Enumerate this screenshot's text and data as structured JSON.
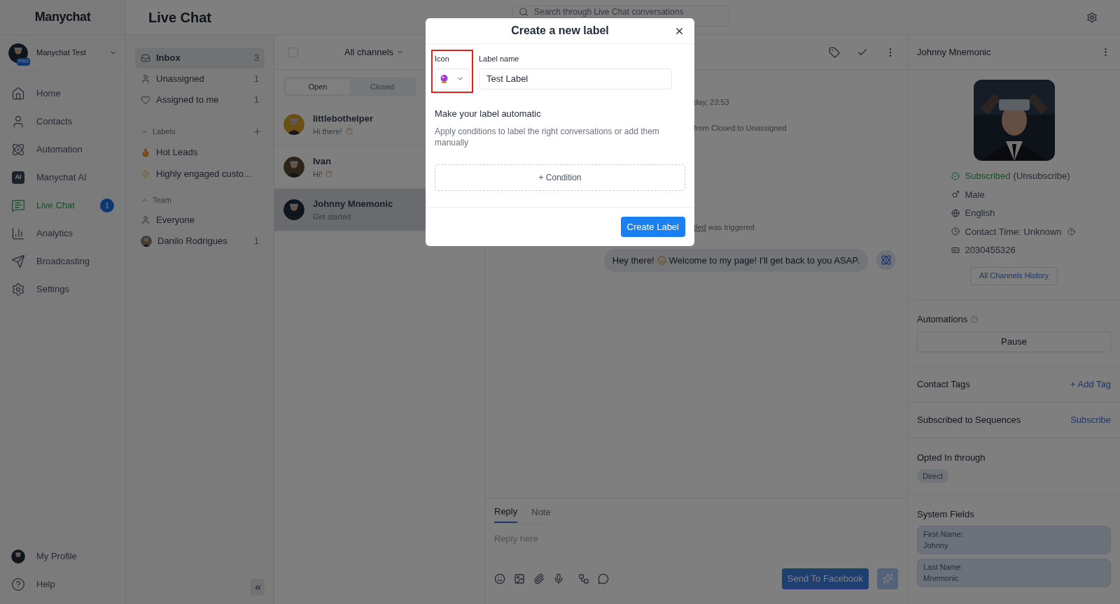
{
  "app": {
    "logo": "Manychat",
    "page_title": "Live Chat",
    "search": {
      "placeholder": "Search through Live Chat conversations"
    }
  },
  "account": {
    "name": "Manychat Test",
    "badge": "PRO"
  },
  "nav": [
    {
      "kind": "home",
      "label": "Home",
      "selected": false
    },
    {
      "kind": "contacts",
      "label": "Contacts",
      "selected": false
    },
    {
      "kind": "automation",
      "label": "Automation",
      "selected": false
    },
    {
      "kind": "ai",
      "icon_text": "AI",
      "label": "Manychat AI",
      "selected": false
    },
    {
      "kind": "chat",
      "label": "Live Chat",
      "selected": true,
      "badge": "1"
    },
    {
      "kind": "analytics",
      "label": "Analytics",
      "selected": false
    },
    {
      "kind": "broadcast",
      "label": "Broadcasting",
      "selected": false
    },
    {
      "kind": "settings",
      "label": "Settings",
      "selected": false
    }
  ],
  "nav_bottom": [
    {
      "kind": "avatar",
      "label": "My Profile"
    },
    {
      "kind": "help",
      "label": "Help"
    }
  ],
  "folders": [
    {
      "kind": "inbox",
      "label": "Inbox",
      "count": "3",
      "selected": true
    },
    {
      "kind": "person",
      "label": "Unassigned",
      "count": "1",
      "selected": false
    },
    {
      "kind": "heart",
      "label": "Assigned to me",
      "count": "1",
      "selected": false
    }
  ],
  "labels_section": {
    "title": "Labels",
    "expanded": true,
    "items": [
      {
        "kind": "fire",
        "label": "Hot Leads"
      },
      {
        "kind": "bolt",
        "label": "Highly engaged custo..."
      }
    ]
  },
  "team_section": {
    "title": "Team",
    "expanded": true,
    "items": [
      {
        "kind": "person",
        "label": "Everyone"
      },
      {
        "kind": "avatar",
        "label": "Danilo Rodrigues",
        "count": "1"
      }
    ]
  },
  "chat_list": {
    "select_all": {
      "checked": false
    },
    "channel_filter": "All channels",
    "tabs": [
      {
        "label": "Open",
        "selected": true
      },
      {
        "label": "Closed",
        "selected": false
      }
    ],
    "conversations": [
      {
        "name": "littlebothelper",
        "preview": "Hi there!",
        "selected": false
      },
      {
        "name": "Ivan",
        "preview": "Hi!",
        "selected": false
      },
      {
        "name": "Johnny Mnemonic",
        "preview": "Get started",
        "selected": true
      }
    ]
  },
  "conversation": {
    "events": [
      {
        "text": "day, 23:53"
      },
      {
        "text": "from Closed to Unassigned"
      },
      {
        "link": "tled",
        "text": "was triggered"
      }
    ],
    "message": {
      "before": "Hey there!",
      "after": "Welcome to my page! I'll get back to you ASAP."
    },
    "composer": {
      "tabs": [
        {
          "label": "Reply",
          "selected": true
        },
        {
          "label": "Note",
          "selected": false
        }
      ],
      "placeholder": "Reply here",
      "send_button": {
        "label": "Send To Facebook",
        "disabled": true
      }
    }
  },
  "contact": {
    "name": "Johnny Mnemonic",
    "status": "Subscribed",
    "status_action": "(Unsubscribe)",
    "gender": "Male",
    "language": "English",
    "contact_time": "Contact Time: Unknown",
    "id": "2030455326",
    "history_button": "All Channels History",
    "automations": {
      "title": "Automations",
      "button": "Pause"
    },
    "tags": {
      "title": "Contact Tags",
      "action": "+ Add Tag"
    },
    "sequences": {
      "title": "Subscribed to Sequences",
      "action": "Subscribe"
    },
    "opted_in": {
      "title": "Opted In through",
      "chip": "Direct"
    },
    "system_fields": {
      "title": "System Fields",
      "fields": [
        {
          "label": "First Name:",
          "value": "Johnny"
        },
        {
          "label": "Last Name:",
          "value": "Mnemonic"
        }
      ]
    }
  },
  "modal": {
    "title": "Create a new label",
    "icon_label": "Icon",
    "icon_highlighted": true,
    "name_label": "Label name",
    "name_value": "Test Label",
    "section_title": "Make your label automatic",
    "description": "Apply conditions to label the right conversations or add them manually",
    "condition_button": "+ Condition",
    "submit_button": "Create Label"
  }
}
